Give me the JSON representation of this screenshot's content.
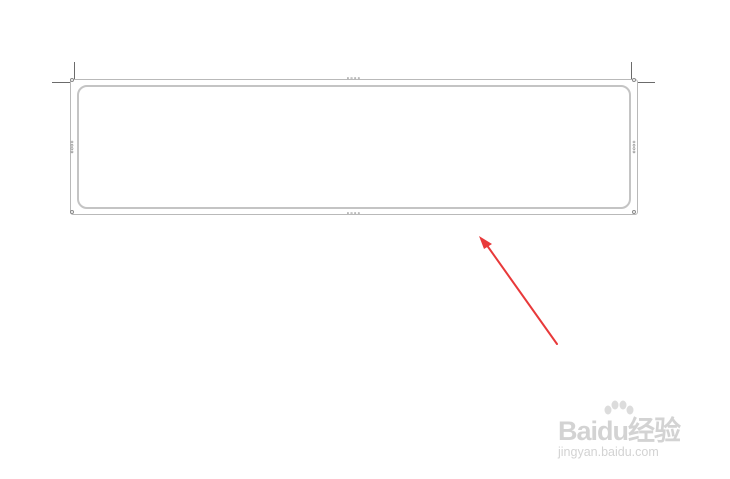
{
  "document": {
    "handle_mark": "∘∘∘∘"
  },
  "annotation": {
    "arrow_color": "#e8393a"
  },
  "watermark": {
    "brand_text": "Baidu经验",
    "url_text": "jingyan.baidu.com",
    "color": "#d3d3d3"
  }
}
